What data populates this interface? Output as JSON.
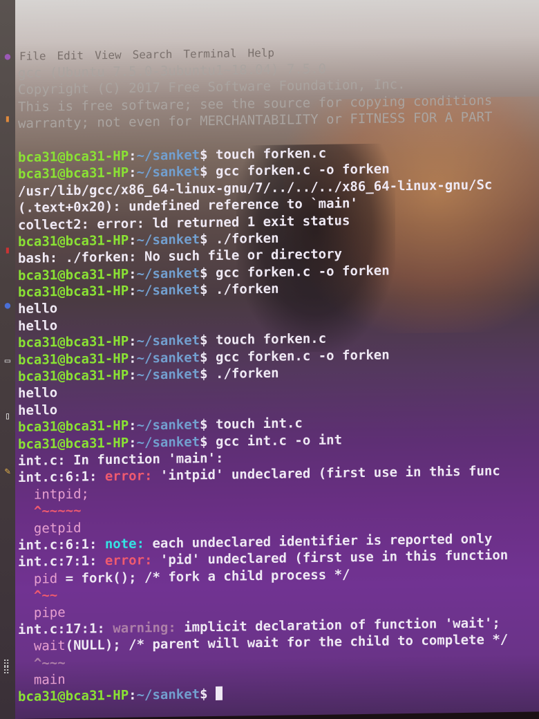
{
  "menu": [
    "File",
    "Edit",
    "View",
    "Search",
    "Terminal",
    "Help"
  ],
  "launcher_icons": [
    "circle-icon",
    "folder-icon",
    "terminal-icon",
    "circle-icon",
    "monitor-icon",
    "document-icon",
    "pencil-icon"
  ],
  "terminal": {
    "lines": [
      {
        "parts": [
          {
            "t": "gcc (Ubuntu 7.5.0-3ubuntu1~18.04) 7.5.0",
            "c": "faint"
          }
        ]
      },
      {
        "parts": [
          {
            "t": "Copyright (C) 2017 Free Software Foundation, Inc.",
            "c": "faint"
          }
        ]
      },
      {
        "parts": [
          {
            "t": "This is free software; see the source for copying conditions",
            "c": "faint"
          }
        ]
      },
      {
        "parts": [
          {
            "t": "warranty; not even for MERCHANTABILITY or FITNESS FOR A PART",
            "c": "faint"
          }
        ]
      },
      {
        "parts": [
          {
            "t": "",
            "c": "w"
          }
        ]
      },
      {
        "parts": [
          {
            "t": "bca31@bca31-HP",
            "c": "u"
          },
          {
            "t": ":",
            "c": "w"
          },
          {
            "t": "~/sanket",
            "c": "p"
          },
          {
            "t": "$ touch forken.c",
            "c": "w"
          }
        ]
      },
      {
        "parts": [
          {
            "t": "bca31@bca31-HP",
            "c": "u"
          },
          {
            "t": ":",
            "c": "w"
          },
          {
            "t": "~/sanket",
            "c": "p"
          },
          {
            "t": "$ gcc forken.c -o forken",
            "c": "w"
          }
        ]
      },
      {
        "parts": [
          {
            "t": "/usr/lib/gcc/x86_64-linux-gnu/7/../../../x86_64-linux-gnu/Sc",
            "c": "w"
          }
        ]
      },
      {
        "parts": [
          {
            "t": "(.text+0x20): undefined reference to `main'",
            "c": "w"
          }
        ]
      },
      {
        "parts": [
          {
            "t": "collect2: error: ld returned 1 exit status",
            "c": "w"
          }
        ]
      },
      {
        "parts": [
          {
            "t": "bca31@bca31-HP",
            "c": "u"
          },
          {
            "t": ":",
            "c": "w"
          },
          {
            "t": "~/sanket",
            "c": "p"
          },
          {
            "t": "$ ./forken",
            "c": "w"
          }
        ]
      },
      {
        "parts": [
          {
            "t": "bash: ./forken: No such file or directory",
            "c": "w"
          }
        ]
      },
      {
        "parts": [
          {
            "t": "bca31@bca31-HP",
            "c": "u"
          },
          {
            "t": ":",
            "c": "w"
          },
          {
            "t": "~/sanket",
            "c": "p"
          },
          {
            "t": "$ gcc forken.c -o forken",
            "c": "w"
          }
        ]
      },
      {
        "parts": [
          {
            "t": "bca31@bca31-HP",
            "c": "u"
          },
          {
            "t": ":",
            "c": "w"
          },
          {
            "t": "~/sanket",
            "c": "p"
          },
          {
            "t": "$ ./forken",
            "c": "w"
          }
        ]
      },
      {
        "parts": [
          {
            "t": "hello",
            "c": "w"
          }
        ]
      },
      {
        "parts": [
          {
            "t": "hello",
            "c": "w"
          }
        ]
      },
      {
        "parts": [
          {
            "t": "bca31@bca31-HP",
            "c": "u"
          },
          {
            "t": ":",
            "c": "w"
          },
          {
            "t": "~/sanket",
            "c": "p"
          },
          {
            "t": "$ touch forken.c",
            "c": "w"
          }
        ]
      },
      {
        "parts": [
          {
            "t": "bca31@bca31-HP",
            "c": "u"
          },
          {
            "t": ":",
            "c": "w"
          },
          {
            "t": "~/sanket",
            "c": "p"
          },
          {
            "t": "$ gcc forken.c -o forken",
            "c": "w"
          }
        ]
      },
      {
        "parts": [
          {
            "t": "bca31@bca31-HP",
            "c": "u"
          },
          {
            "t": ":",
            "c": "w"
          },
          {
            "t": "~/sanket",
            "c": "p"
          },
          {
            "t": "$ ./forken",
            "c": "w"
          }
        ]
      },
      {
        "parts": [
          {
            "t": "hello",
            "c": "w"
          }
        ]
      },
      {
        "parts": [
          {
            "t": "hello",
            "c": "w"
          }
        ]
      },
      {
        "parts": [
          {
            "t": "bca31@bca31-HP",
            "c": "u"
          },
          {
            "t": ":",
            "c": "w"
          },
          {
            "t": "~/sanket",
            "c": "p"
          },
          {
            "t": "$ touch int.c",
            "c": "w"
          }
        ]
      },
      {
        "parts": [
          {
            "t": "bca31@bca31-HP",
            "c": "u"
          },
          {
            "t": ":",
            "c": "w"
          },
          {
            "t": "~/sanket",
            "c": "p"
          },
          {
            "t": "$ gcc int.c -o int",
            "c": "w"
          }
        ]
      },
      {
        "parts": [
          {
            "t": "int.c: In function 'main':",
            "c": "w"
          }
        ]
      },
      {
        "parts": [
          {
            "t": "int.c:6:1: ",
            "c": "w"
          },
          {
            "t": "error: ",
            "c": "err"
          },
          {
            "t": "'intpid' undeclared (first use in this func",
            "c": "w"
          }
        ]
      },
      {
        "parts": [
          {
            "t": "  intpid;",
            "c": "src"
          }
        ]
      },
      {
        "parts": [
          {
            "t": "  ^~~~~~",
            "c": "err"
          }
        ]
      },
      {
        "parts": [
          {
            "t": "  getpid",
            "c": "src"
          }
        ]
      },
      {
        "parts": [
          {
            "t": "int.c:6:1: ",
            "c": "w"
          },
          {
            "t": "note: ",
            "c": "note"
          },
          {
            "t": "each undeclared identifier is reported only",
            "c": "w"
          }
        ]
      },
      {
        "parts": [
          {
            "t": "int.c:7:1: ",
            "c": "w"
          },
          {
            "t": "error: ",
            "c": "err"
          },
          {
            "t": "'pid' undeclared (first use in this function",
            "c": "w"
          }
        ]
      },
      {
        "parts": [
          {
            "t": "  pid",
            "c": "src"
          },
          {
            "t": " = fork(); /* fork a child process */",
            "c": "w"
          }
        ]
      },
      {
        "parts": [
          {
            "t": "  ^~~",
            "c": "err"
          }
        ]
      },
      {
        "parts": [
          {
            "t": "  pipe",
            "c": "src"
          }
        ]
      },
      {
        "parts": [
          {
            "t": "int.c:17:1: ",
            "c": "w"
          },
          {
            "t": "warning: ",
            "c": "warn"
          },
          {
            "t": "implicit declaration of function 'wait';",
            "c": "w"
          }
        ]
      },
      {
        "parts": [
          {
            "t": "  wait",
            "c": "src"
          },
          {
            "t": "(NULL); /* parent will wait for the child to complete */",
            "c": "w"
          }
        ]
      },
      {
        "parts": [
          {
            "t": "  ^~~~",
            "c": "warn"
          }
        ]
      },
      {
        "parts": [
          {
            "t": "  main",
            "c": "src"
          }
        ]
      },
      {
        "parts": [
          {
            "t": "bca31@bca31-HP",
            "c": "u"
          },
          {
            "t": ":",
            "c": "w"
          },
          {
            "t": "~/sanket",
            "c": "p"
          },
          {
            "t": "$ ",
            "c": "w"
          }
        ],
        "cursor": true
      }
    ]
  }
}
